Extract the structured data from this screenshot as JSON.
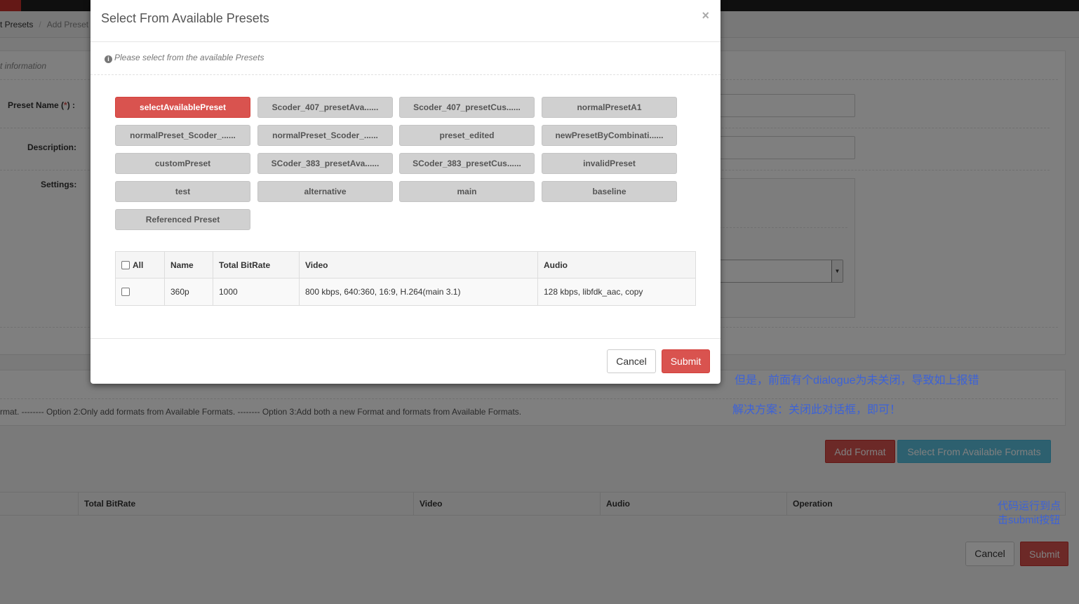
{
  "breadcrumb": {
    "item1": "t Presets",
    "item2": "Add Preset"
  },
  "form": {
    "section_note": "t information",
    "preset_name_label": "Preset Name (",
    "preset_name_req": "*",
    "preset_name_label_end": ") :",
    "description_label": "Description:",
    "settings_label": "Settings:"
  },
  "formats": {
    "options_text": "rmat. -------- Option 2:Only add formats from Available Formats. -------- Option 3:Add both a new Format and formats from Available Formats.",
    "add_format": "Add Format",
    "select_available": "Select From Available Formats",
    "columns": [
      "Total BitRate",
      "Video",
      "Audio",
      "Operation"
    ],
    "cancel": "Cancel",
    "submit": "Submit"
  },
  "annotations": {
    "line1": "但是，前面有个dialogue为未关闭，导致如上报错",
    "line2": "解决方案：关闭此对话框，即可！",
    "code_note": "代码运行到点击submit按钮"
  },
  "modal": {
    "title": "Select From Available Presets",
    "close": "×",
    "info": "Please select from the available Presets",
    "presets": [
      "selectAvailablePreset",
      "Scoder_407_presetAva......",
      "Scoder_407_presetCus......",
      "normalPresetA1",
      "normalPreset_Scoder_......",
      "normalPreset_Scoder_......",
      "preset_edited",
      "newPresetByCombinati......",
      "customPreset",
      "SCoder_383_presetAva......",
      "SCoder_383_presetCus......",
      "invalidPreset",
      "test",
      "alternative",
      "main",
      "baseline",
      "Referenced Preset"
    ],
    "active_index": 0,
    "table": {
      "headers": {
        "all": "All",
        "name": "Name",
        "bitrate": "Total BitRate",
        "video": "Video",
        "audio": "Audio"
      },
      "rows": [
        {
          "name": "360p",
          "bitrate": "1000",
          "video": "800 kbps, 640:360, 16:9, H.264(main 3.1)",
          "audio": "128 kbps, libfdk_aac, copy"
        }
      ]
    },
    "cancel": "Cancel",
    "submit": "Submit"
  }
}
